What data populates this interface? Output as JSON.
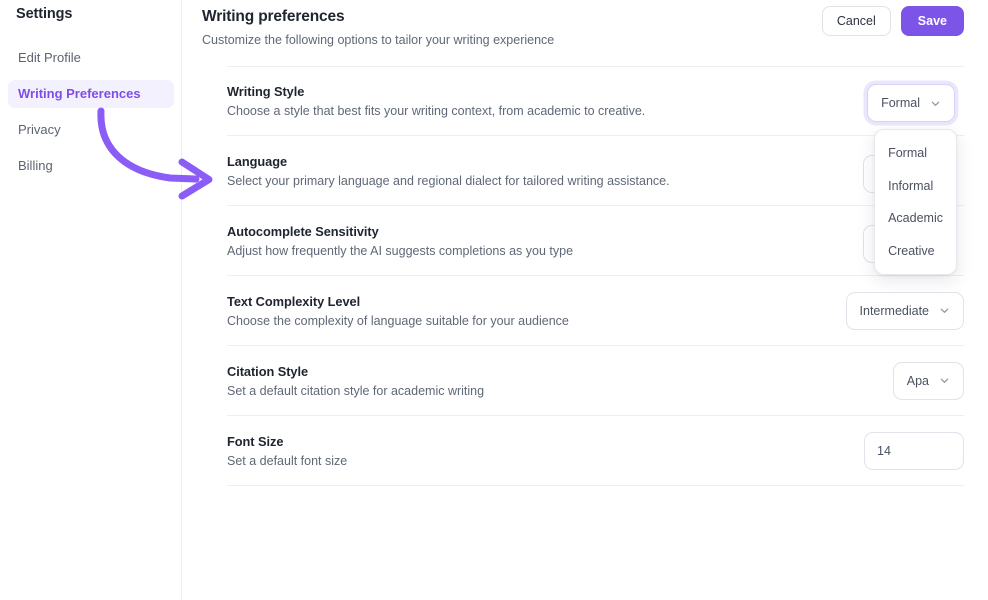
{
  "sidebar": {
    "title": "Settings",
    "items": [
      {
        "label": "Edit Profile",
        "active": false
      },
      {
        "label": "Writing Preferences",
        "active": true
      },
      {
        "label": "Privacy",
        "active": false
      },
      {
        "label": "Billing",
        "active": false
      }
    ]
  },
  "header": {
    "title": "Writing preferences",
    "subtitle": "Customize the following options to tailor your writing experience",
    "cancel_label": "Cancel",
    "save_label": "Save"
  },
  "settings": [
    {
      "label": "Writing Style",
      "description": "Choose a style that best fits your writing context, from academic to creative.",
      "control": "select-open",
      "value": "Formal"
    },
    {
      "label": "Language",
      "description": "Select your primary language and regional dialect for tailored writing assistance.",
      "control": "select-hidden",
      "value": ""
    },
    {
      "label": "Autocomplete Sensitivity",
      "description": "Adjust how frequently the AI suggests completions as you type",
      "control": "select-hidden",
      "value": ""
    },
    {
      "label": "Text Complexity Level",
      "description": "Choose the complexity of language suitable for your audience",
      "control": "select",
      "value": "Intermediate"
    },
    {
      "label": "Citation Style",
      "description": "Set a default citation style for academic writing",
      "control": "select",
      "value": "Apa"
    },
    {
      "label": "Font Size",
      "description": "Set a default font size",
      "control": "number",
      "value": "14"
    }
  ],
  "writing_style_dropdown": {
    "open": true,
    "selected": "Formal",
    "options": [
      "Formal",
      "Informal",
      "Academic",
      "Creative"
    ]
  },
  "annotation": {
    "type": "curved-arrow",
    "color": "#8b5cf6",
    "points_to": "Language"
  },
  "colors": {
    "accent": "#7c54e8",
    "accent_soft_bg": "#f4f1fe",
    "annotation_purple": "#8b5cf6",
    "text_primary": "#1f2430",
    "text_secondary": "#5f6876",
    "border": "#e0e3e9",
    "divider": "#edeff2"
  }
}
